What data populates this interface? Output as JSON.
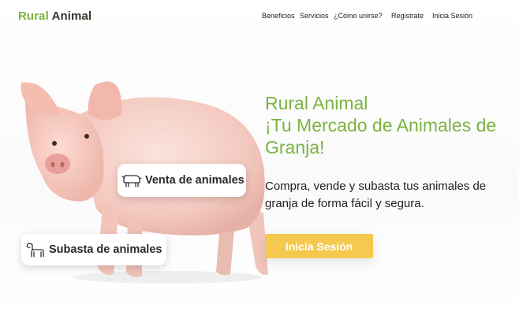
{
  "brand": {
    "part1": "Rural",
    "part2": "Animal"
  },
  "nav": [
    "Beneficios",
    "Servicios",
    "¿Cómo unirse?",
    "Registrate",
    "Inicia Sesión"
  ],
  "hero": {
    "title_lines": [
      "Rural Animal",
      "¡Tu Mercado de Animales de",
      "Granja!"
    ],
    "subtitle": "Compra, vende y subasta tus animales de granja de forma fácil y segura.",
    "cta_label": "Inicia Sesión"
  },
  "badges": {
    "venta": {
      "label": "Venta de animales",
      "icon": "livestock-icon"
    },
    "subasta": {
      "label": "Subasta de animales",
      "icon": "animal-icon"
    }
  },
  "colors": {
    "brand_green": "#7cb342",
    "cta_yellow": "#f5c94e"
  }
}
